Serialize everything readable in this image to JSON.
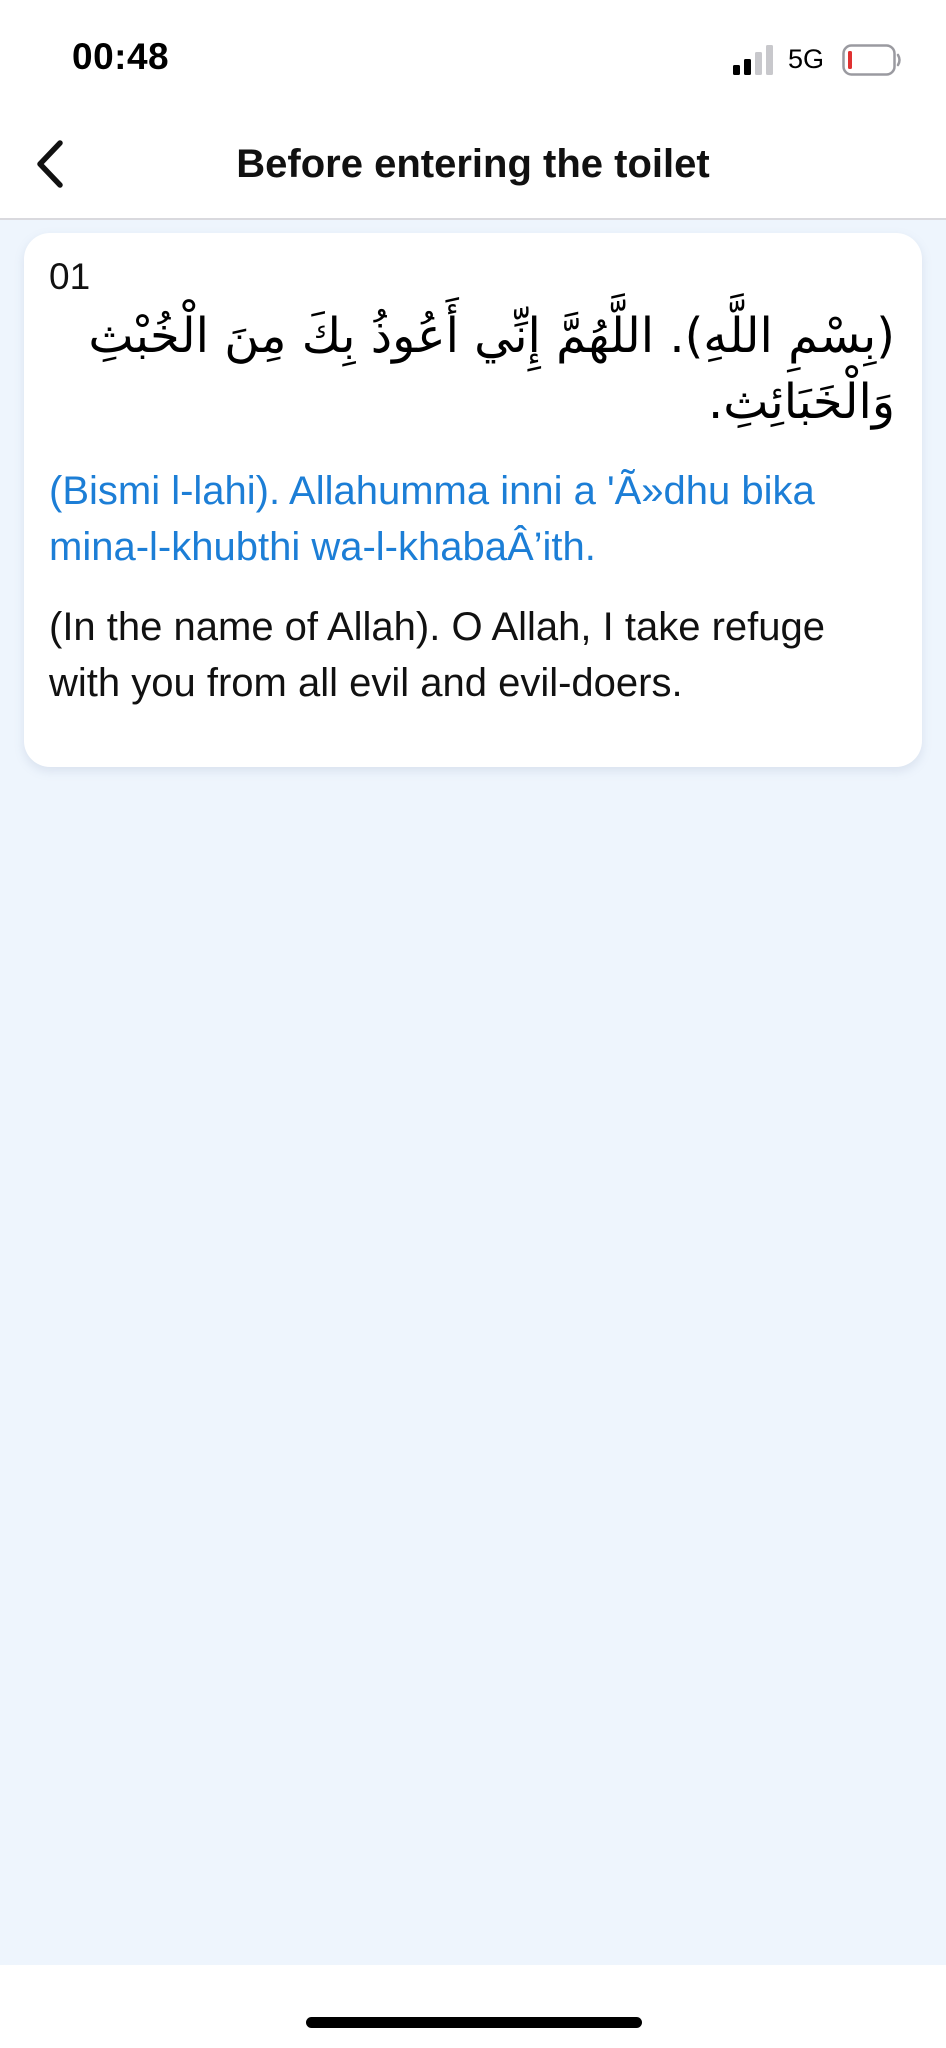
{
  "status_bar": {
    "time": "00:48",
    "network": "5G",
    "signal_icon": "cellular-signal-icon",
    "battery_icon": "battery-low-icon",
    "battery_level": 0.08,
    "signal_bars_active": 2,
    "signal_bars_total": 4
  },
  "header": {
    "back_icon": "chevron-left-icon",
    "title": "Before entering the toilet"
  },
  "dua": {
    "number": "01",
    "arabic": "(بِسْمِ اللَّهِ). اللَّهُمَّ إِنِّي أَعُوذُ بِكَ مِنَ الْخُبْثِ وَالْخَبَائِثِ.",
    "transliteration": "(Bismi l-lahi). Allahumma inni a 'Ã»dhu bika mina-l-khubthi wa-l-khabaÂ’ith.",
    "translation": "(In the name of Allah). O Allah, I take refuge with you from all evil and evil-doers."
  },
  "colors": {
    "accent": "#1c7ed6",
    "background": "#eef5fd",
    "battery_low": "#e03131"
  }
}
